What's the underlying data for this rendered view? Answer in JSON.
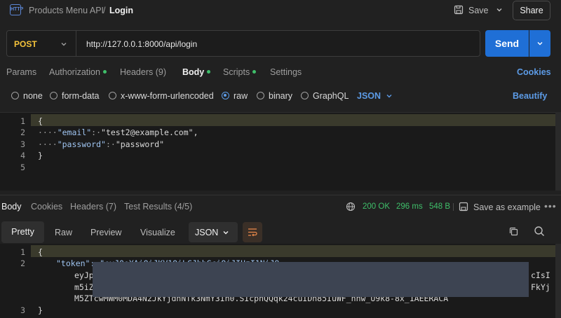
{
  "header": {
    "breadcrumb_parent": "Products Menu API",
    "breadcrumb_sep": "/",
    "breadcrumb_current": "Login",
    "save_label": "Save",
    "share_label": "Share",
    "logo_text": "HTTP"
  },
  "request": {
    "method": "POST",
    "url": "http://127.0.0.1:8000/api/login",
    "send_label": "Send"
  },
  "request_tabs": {
    "params": "Params",
    "authorization": "Authorization",
    "headers": "Headers (9)",
    "body": "Body",
    "scripts": "Scripts",
    "settings": "Settings",
    "cookies": "Cookies"
  },
  "body_types": {
    "none": "none",
    "form_data": "form-data",
    "urlencoded": "x-www-form-urlencoded",
    "raw": "raw",
    "binary": "binary",
    "graphql": "GraphQL",
    "format": "JSON",
    "beautify": "Beautify",
    "selected": "raw"
  },
  "request_body": {
    "line_numbers": [
      "1",
      "2",
      "3",
      "4",
      "5"
    ],
    "open_brace": "{",
    "dots2": "····",
    "key1": "\"email\"",
    "colon1": ":·",
    "val1": "\"test2@example.com\"",
    "comma1": ",",
    "dots3": "····",
    "key2": "\"password\"",
    "colon2": ":·",
    "val2": "\"password\"",
    "close_brace": "}"
  },
  "response_tabs": {
    "body": "Body",
    "cookies": "Cookies",
    "headers": "Headers (7)",
    "test_results": "Test Results (4/5)"
  },
  "response_meta": {
    "status": "200 OK",
    "time": "296 ms",
    "size": "548 B",
    "save_example": "Save as example",
    "more": "•••"
  },
  "view_tabs": {
    "pretty": "Pretty",
    "raw": "Raw",
    "preview": "Preview",
    "visualize": "Visualize",
    "format": "JSON"
  },
  "response_body": {
    "ln1": "1",
    "ln2": "2",
    "ln3": "3",
    "open_brace": "{",
    "token_line": "\"token\": \"eyJ0eXAiOiJKV1QiLCJhbGciOiJIUzI1NiJ9",
    "cont1_left": "eyJp",
    "cont1_right": "cIsI",
    "cont2_left": "m5iZ",
    "cont2_right": "FkYj",
    "cont3": "M5ZTcwMWM0MDA4N2JkYjdhNTk3NmY3In0.SIcpnQQqk24cuIDn85IuWF_nnw_U9k8-8x_1AEERACA",
    "close_brace": "}"
  }
}
